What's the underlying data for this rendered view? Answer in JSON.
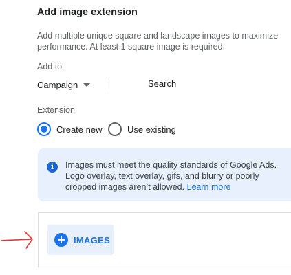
{
  "panel": {
    "title": "Add image extension",
    "description": "Add multiple unique square and landscape images to maximize performance. At least 1 square image is required."
  },
  "add_to": {
    "label": "Add to",
    "selected_value": "Campaign",
    "search_label": "Search"
  },
  "extension": {
    "label": "Extension",
    "options": [
      {
        "label": "Create new",
        "checked": true
      },
      {
        "label": "Use existing",
        "checked": false
      }
    ]
  },
  "info": {
    "icon": "info-icon",
    "text": "Images must meet the quality standards of Google Ads. Logo overlay, text overlay, gifs, and blurry or poorly cropped images aren’t allowed.",
    "link_label": "Learn more"
  },
  "images_button": {
    "icon": "plus-circle-icon",
    "label": "IMAGES"
  },
  "colors": {
    "accent": "#1a73e8",
    "info_background": "#e8f0fe",
    "annotation": "#e53935"
  },
  "annotation": {
    "icon": "red-arrow-annotation"
  }
}
